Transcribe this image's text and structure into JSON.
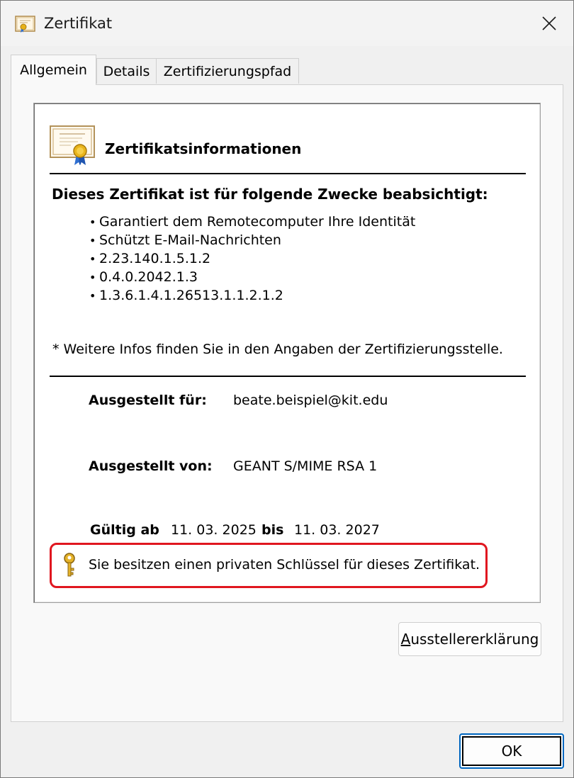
{
  "window": {
    "title": "Zertifikat",
    "close_label": "✕"
  },
  "tabs": [
    {
      "label": "Allgemein",
      "active": true
    },
    {
      "label": "Details",
      "active": false
    },
    {
      "label": "Zertifizierungspfad",
      "active": false
    }
  ],
  "info": {
    "heading": "Zertifikatsinformationen",
    "purposes_title": "Dieses Zertifikat ist für folgende Zwecke beabsichtigt:",
    "purposes": [
      "Garantiert dem Remotecomputer Ihre Identität",
      "Schützt E-Mail-Nachrichten",
      "2.23.140.1.5.1.2",
      "0.4.0.2042.1.3",
      "1.3.6.1.4.1.26513.1.1.2.1.2"
    ],
    "bullet": "•",
    "note": "* Weitere Infos finden Sie in den Angaben der Zertifizierungsstelle.",
    "issued_to_label": "Ausgestellt für:",
    "issued_to_value": "beate.beispiel@kit.edu",
    "issued_by_label": "Ausgestellt von:",
    "issued_by_value": "GEANT S/MIME RSA 1",
    "valid_from_label": "Gültig ab",
    "valid_from_value": "11. 03. 2025",
    "valid_to_label": "bis",
    "valid_to_value": "11. 03. 2027",
    "private_key_text": "Sie besitzen einen privaten Schlüssel für dieses Zertifikat."
  },
  "buttons": {
    "issuer_statement_access_key": "A",
    "issuer_statement_rest": "usstellererklärung",
    "ok_label": "OK"
  },
  "colors": {
    "highlight_border": "#e0161f",
    "ok_focus": "#0067c0"
  },
  "icons": {
    "title": "certificate-icon",
    "cert": "certificate-icon",
    "key": "key-icon",
    "close": "close-icon"
  }
}
